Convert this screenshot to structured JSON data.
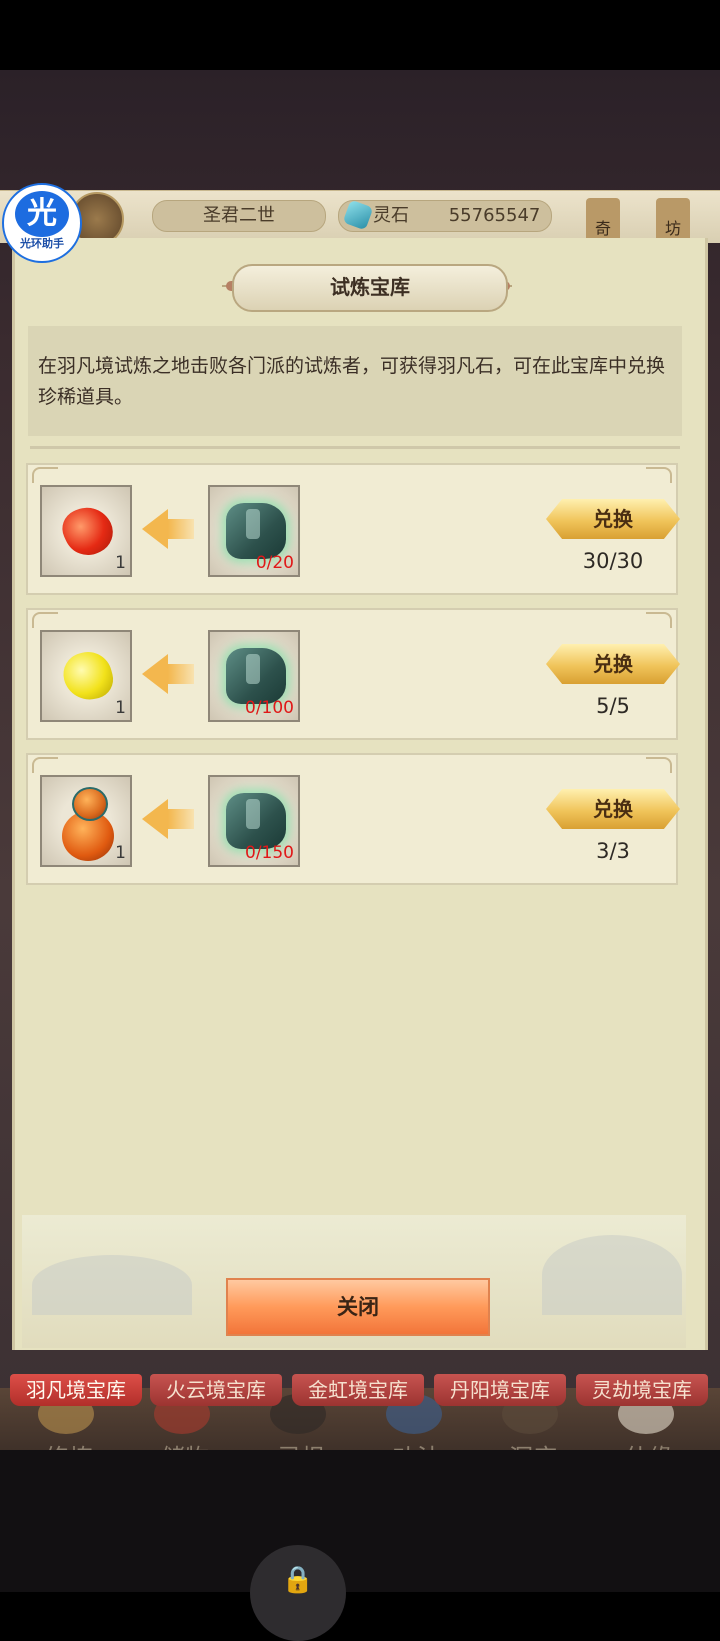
{
  "hud": {
    "player_title": "圣君二世",
    "currency_label": "灵石",
    "currency_value": "55765547",
    "side_tab_1": "奇",
    "side_tab_2": "坊"
  },
  "helper": {
    "glyph": "光",
    "label": "光环助手"
  },
  "panel": {
    "title": "试炼宝库",
    "description": "在羽凡境试炼之地击败各门派的试炼者，可获得羽凡石，可在此宝库中兑换珍稀道具。",
    "close_label": "关闭"
  },
  "exchange_items": [
    {
      "reward_icon": "red-gem-icon",
      "reward_qty": "1",
      "cost_icon": "yufan-stone-icon",
      "cost": "0/20",
      "button": "兑换",
      "remaining": "30/30"
    },
    {
      "reward_icon": "yellow-gem-icon",
      "reward_qty": "1",
      "cost_icon": "yufan-stone-icon",
      "cost": "0/100",
      "button": "兑换",
      "remaining": "5/5"
    },
    {
      "reward_icon": "gourd-icon",
      "reward_qty": "1",
      "cost_icon": "yufan-stone-icon",
      "cost": "0/150",
      "button": "兑换",
      "remaining": "3/3"
    }
  ],
  "vault_tabs": [
    "羽凡境宝库",
    "火云境宝库",
    "金虹境宝库",
    "丹阳境宝库",
    "灵劫境宝库"
  ],
  "bottom_nav": [
    "修炼",
    "储物",
    "灵根",
    "功法",
    "洞府",
    "仙缘"
  ],
  "colors": {
    "accent_gold": "#f0c45a",
    "cost_red": "#e01818",
    "tab_red": "#b22f2a"
  }
}
